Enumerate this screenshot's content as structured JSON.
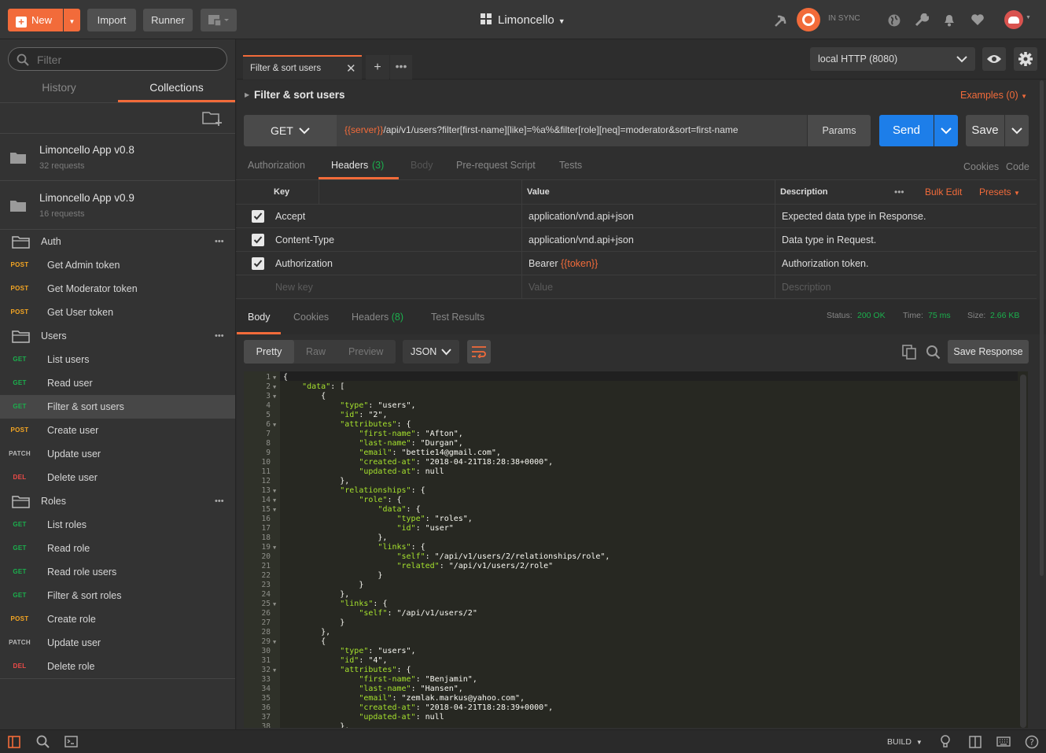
{
  "topbar": {
    "new_label": "New",
    "import_label": "Import",
    "runner_label": "Runner",
    "workspace": "Limoncello",
    "sync_status": "IN SYNC"
  },
  "sidebar": {
    "filter_placeholder": "Filter",
    "tab_history": "History",
    "tab_collections": "Collections",
    "collections": [
      {
        "name": "Limoncello App v0.8",
        "count": "32 requests"
      },
      {
        "name": "Limoncello App v0.9",
        "count": "16 requests"
      }
    ],
    "rows": [
      {
        "kind": "folder",
        "label": "Auth"
      },
      {
        "kind": "req",
        "method": "POST",
        "cls": "p",
        "label": "Get Admin token"
      },
      {
        "kind": "req",
        "method": "POST",
        "cls": "p",
        "label": "Get Moderator token"
      },
      {
        "kind": "req",
        "method": "POST",
        "cls": "p",
        "label": "Get User token"
      },
      {
        "kind": "folder",
        "label": "Users"
      },
      {
        "kind": "req",
        "method": "GET",
        "cls": "g",
        "label": "List users"
      },
      {
        "kind": "req",
        "method": "GET",
        "cls": "g",
        "label": "Read user"
      },
      {
        "kind": "req",
        "method": "GET",
        "cls": "g",
        "label": "Filter & sort users",
        "active": true
      },
      {
        "kind": "req",
        "method": "POST",
        "cls": "p",
        "label": "Create user"
      },
      {
        "kind": "req",
        "method": "PATCH",
        "cls": "pa",
        "label": "Update user"
      },
      {
        "kind": "req",
        "method": "DEL",
        "cls": "d",
        "label": "Delete user"
      },
      {
        "kind": "folder",
        "label": "Roles"
      },
      {
        "kind": "req",
        "method": "GET",
        "cls": "g",
        "label": "List roles"
      },
      {
        "kind": "req",
        "method": "GET",
        "cls": "g",
        "label": "Read role"
      },
      {
        "kind": "req",
        "method": "GET",
        "cls": "g",
        "label": "Read role users"
      },
      {
        "kind": "req",
        "method": "GET",
        "cls": "g",
        "label": "Filter & sort roles"
      },
      {
        "kind": "req",
        "method": "POST",
        "cls": "p",
        "label": "Create role"
      },
      {
        "kind": "req",
        "method": "PATCH",
        "cls": "pa",
        "label": "Update user"
      },
      {
        "kind": "req",
        "method": "DEL",
        "cls": "d",
        "label": "Delete role"
      }
    ]
  },
  "request": {
    "tab_title": "Filter & sort users",
    "environment": "local HTTP (8080)",
    "name": "Filter & sort users",
    "examples": "Examples (0)",
    "method": "GET",
    "url_var": "{{server}}",
    "url_rest": "/api/v1/users?filter[first-name][like]=%a%&filter[role][neq]=moderator&sort=first-name",
    "params_label": "Params",
    "send_label": "Send",
    "save_label": "Save",
    "tabs": {
      "authorization": "Authorization",
      "headers": "Headers",
      "headers_count": "(3)",
      "body": "Body",
      "prerequest": "Pre-request Script",
      "tests": "Tests",
      "cookies": "Cookies",
      "code": "Code"
    },
    "table": {
      "col_key": "Key",
      "col_value": "Value",
      "col_desc": "Description",
      "bulk_edit": "Bulk Edit",
      "presets": "Presets",
      "rows": [
        {
          "key": "Accept",
          "value": "application/vnd.api+json",
          "value_var": "",
          "desc": "Expected data type in Response."
        },
        {
          "key": "Content-Type",
          "value": "application/vnd.api+json",
          "value_var": "",
          "desc": "Data type in Request."
        },
        {
          "key": "Authorization",
          "value": "Bearer ",
          "value_var": "{{token}}",
          "desc": "Authorization token."
        }
      ],
      "new_key": "New key",
      "new_value": "Value",
      "new_desc": "Description"
    }
  },
  "response": {
    "tabs": {
      "body": "Body",
      "cookies": "Cookies",
      "headers": "Headers",
      "headers_count": "(8)",
      "test_results": "Test Results"
    },
    "status_label": "Status:",
    "status_value": "200 OK",
    "time_label": "Time:",
    "time_value": "75 ms",
    "size_label": "Size:",
    "size_value": "2.66 KB",
    "view_pretty": "Pretty",
    "view_raw": "Raw",
    "view_preview": "Preview",
    "format": "JSON",
    "save_response": "Save Response",
    "code_lines": [
      "{",
      "    \"data\": [",
      "        {",
      "            \"type\": \"users\",",
      "            \"id\": \"2\",",
      "            \"attributes\": {",
      "                \"first-name\": \"Afton\",",
      "                \"last-name\": \"Durgan\",",
      "                \"email\": \"bettie14@gmail.com\",",
      "                \"created-at\": \"2018-04-21T18:28:38+0000\",",
      "                \"updated-at\": null",
      "            },",
      "            \"relationships\": {",
      "                \"role\": {",
      "                    \"data\": {",
      "                        \"type\": \"roles\",",
      "                        \"id\": \"user\"",
      "                    },",
      "                    \"links\": {",
      "                        \"self\": \"/api/v1/users/2/relationships/role\",",
      "                        \"related\": \"/api/v1/users/2/role\"",
      "                    }",
      "                }",
      "            },",
      "            \"links\": {",
      "                \"self\": \"/api/v1/users/2\"",
      "            }",
      "        },",
      "        {",
      "            \"type\": \"users\",",
      "            \"id\": \"4\",",
      "            \"attributes\": {",
      "                \"first-name\": \"Benjamin\",",
      "                \"last-name\": \"Hansen\",",
      "                \"email\": \"zemlak.markus@yahoo.com\",",
      "                \"created-at\": \"2018-04-21T18:28:39+0000\",",
      "                \"updated-at\": null",
      "            },"
    ],
    "folded_lines": [
      1,
      2,
      3,
      6,
      13,
      14,
      15,
      19,
      25,
      29,
      32
    ]
  },
  "statusbar": {
    "build_label": "BUILD"
  }
}
